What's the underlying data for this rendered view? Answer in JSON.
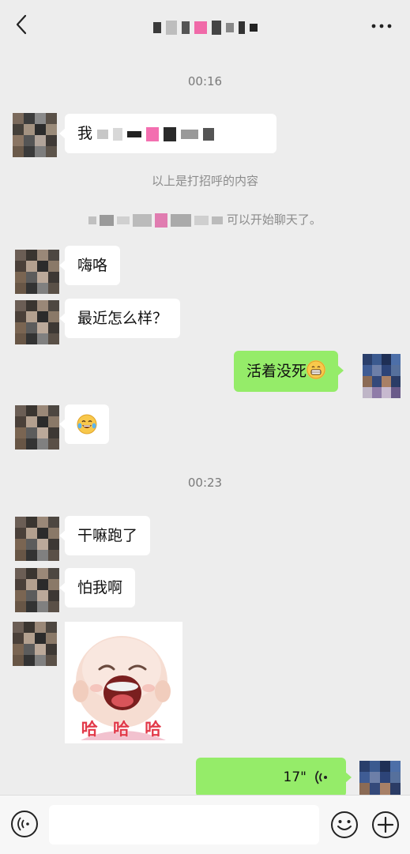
{
  "header": {
    "back_icon": "chevron-left-icon",
    "more_icon": "more-dots-icon"
  },
  "conversation": {
    "time_1": "00:16",
    "greeting_prefix": "我",
    "system_greeting": "以上是打招呼的内容",
    "system_start_suffix": "可以开始聊天了。",
    "time_2": "00:23"
  },
  "messages": {
    "m1": "嗨咯",
    "m2": "最近怎么样？",
    "m3": "活着没死",
    "m5": "干嘛跑了",
    "m6": "怕我啊",
    "sticker_caption": "哈 哈 哈",
    "voice_duration": "17\""
  },
  "colors": {
    "background": "#ededed",
    "my_bubble": "#95ec69",
    "other_bubble": "#ffffff"
  },
  "bottom_bar": {
    "voice_icon": "voice-input-icon",
    "emoji_icon": "emoji-icon",
    "plus_icon": "plus-icon"
  }
}
